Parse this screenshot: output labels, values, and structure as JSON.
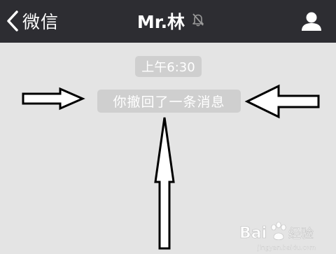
{
  "navbar": {
    "back_label": "微信",
    "title": "Mr.林",
    "icons": {
      "back": "chevron-left-icon",
      "mute": "mute-bell-icon",
      "profile": "person-icon"
    }
  },
  "chat": {
    "timestamp": "上午6:30",
    "recall_notice": "你撤回了一条消息"
  },
  "annotations": {
    "arrows": [
      "arrow-right",
      "arrow-left",
      "arrow-up"
    ]
  },
  "watermark": {
    "text": "Bai 经验",
    "subtext": "jingyan.baidu.com"
  },
  "colors": {
    "navbar_bg": "#2d2d32",
    "chat_bg": "#e4e4e4",
    "bubble_bg": "#cfcfcf",
    "text_light": "#ffffff"
  }
}
